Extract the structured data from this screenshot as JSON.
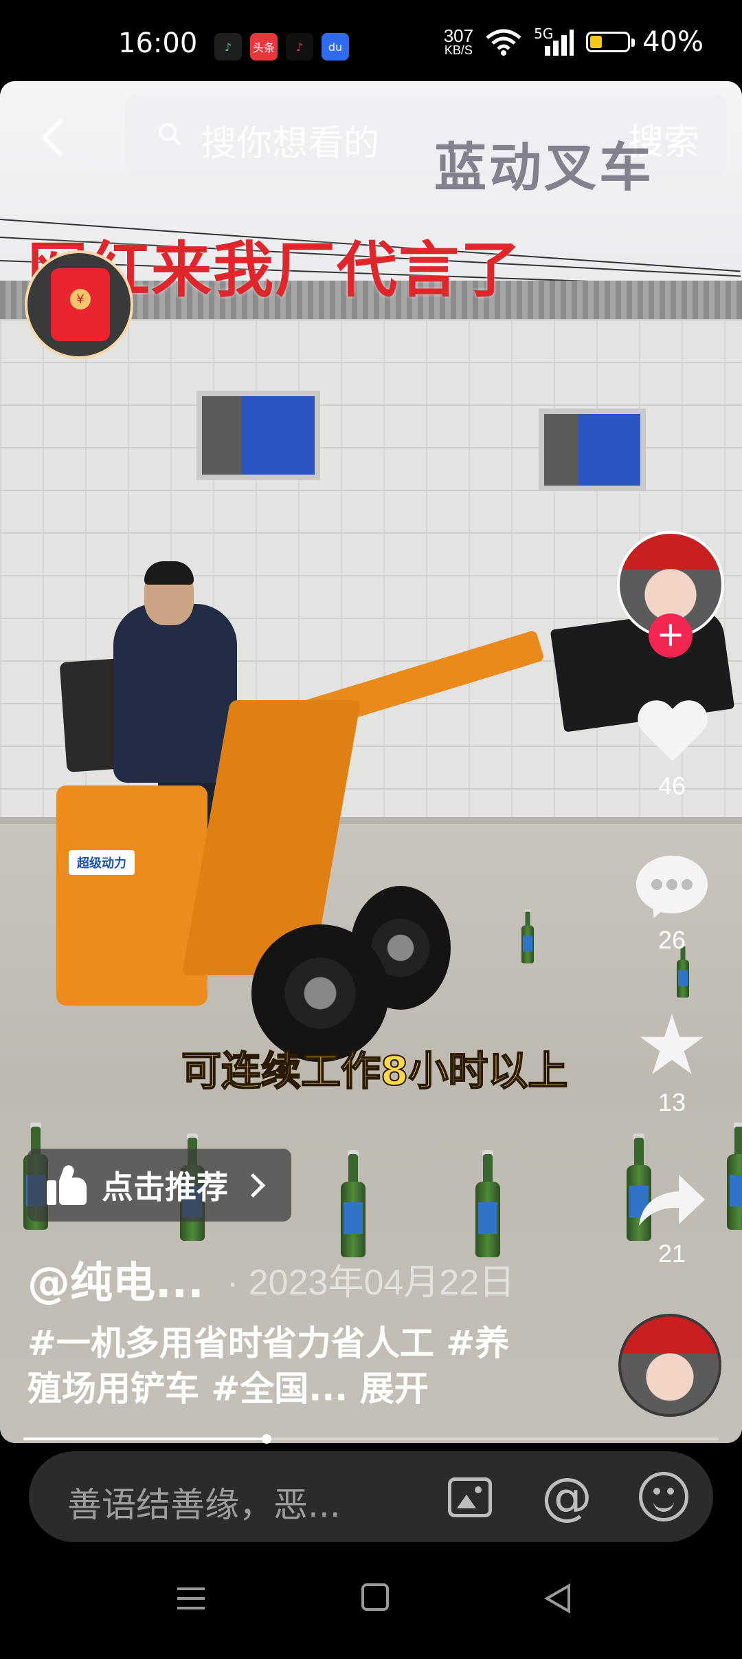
{
  "status_bar": {
    "time": "16:00",
    "apps": [
      {
        "name": "qq-music-icon",
        "text": "♪",
        "color": "#1f1f1f"
      },
      {
        "name": "toutiao-icon",
        "text": "头条",
        "color": "#e8383d"
      },
      {
        "name": "douyin-icon",
        "text": "♪",
        "color": "#111111"
      },
      {
        "name": "baidu-icon",
        "text": "du",
        "color": "#2f6bf0"
      }
    ],
    "net_speed_value": "307",
    "net_speed_unit": "KB/S",
    "signal": "5G",
    "battery_percent": "40%",
    "battery_level": 0.4
  },
  "search": {
    "placeholder": "搜你想看的",
    "button": "搜索"
  },
  "video": {
    "watermark": "蓝动叉车",
    "headline": "网红来我厂代言了",
    "subtitle": "可连续工作8小时以上",
    "sticker": "超级动力",
    "progress": 0.35
  },
  "redpacket": {
    "seal": "¥"
  },
  "rail": {
    "likes": "46",
    "comments": "26",
    "favorites": "13",
    "shares": "21",
    "follow": "+"
  },
  "recommend": {
    "label": "点击推荐"
  },
  "post": {
    "author": "@纯电...",
    "date": "· 2023年04月22日",
    "description": "#一机多用省时省力省人工 #养殖场用铲车 #全国...",
    "expand": "展开"
  },
  "comment_bar": {
    "placeholder": "善语结善缘，恶..."
  },
  "colors": {
    "accent_red": "#f22651",
    "headline_red": "#e0262a",
    "subtitle_yellow": "#ffd84a",
    "loader_orange": "#ec8c1c"
  }
}
